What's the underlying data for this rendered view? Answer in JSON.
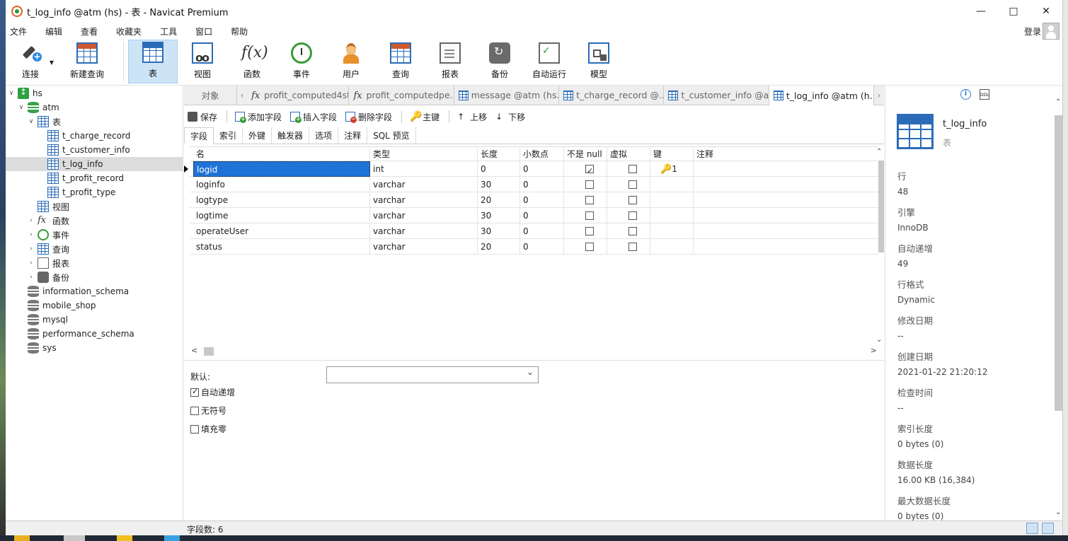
{
  "window": {
    "title": "t_log_info @atm (hs) - 表 - Navicat Premium"
  },
  "menu": {
    "items": [
      "文件",
      "编辑",
      "查看",
      "收藏夹",
      "工具",
      "窗口",
      "帮助"
    ],
    "login": "登录"
  },
  "toolbar": {
    "connect": "连接",
    "new_query": "新建查询",
    "table": "表",
    "view": "视图",
    "function": "函数",
    "event": "事件",
    "user": "用户",
    "query": "查询",
    "report": "报表",
    "backup": "备份",
    "automation": "自动运行",
    "model": "模型"
  },
  "tree": {
    "connection": "hs",
    "database": "atm",
    "tables_group": "表",
    "tables": [
      "t_charge_record",
      "t_customer_info",
      "t_log_info",
      "t_profit_record",
      "t_profit_type"
    ],
    "groups": [
      "视图",
      "函数",
      "事件",
      "查询",
      "报表",
      "备份"
    ],
    "other_dbs": [
      "information_schema",
      "mobile_shop",
      "mysql",
      "performance_schema",
      "sys"
    ]
  },
  "tabs": {
    "objects": "对象",
    "items": [
      "profit_computed4st...",
      "profit_computedpe...",
      "message @atm (hs...",
      "t_charge_record @...",
      "t_customer_info @a...",
      "t_log_info @atm (h..."
    ]
  },
  "actions": {
    "save": "保存",
    "add_field": "添加字段",
    "insert_field": "插入字段",
    "delete_field": "删除字段",
    "primary_key": "主键",
    "move_up": "上移",
    "move_down": "下移"
  },
  "field_tabs": [
    "字段",
    "索引",
    "外键",
    "触发器",
    "选项",
    "注释",
    "SQL 预览"
  ],
  "grid": {
    "headers": [
      "名",
      "类型",
      "长度",
      "小数点",
      "不是 null",
      "虚拟",
      "键",
      "注释"
    ],
    "rows": [
      {
        "name": "logid",
        "type": "int",
        "length": "0",
        "decimals": "0",
        "not_null": true,
        "virtual": false,
        "key": "1"
      },
      {
        "name": "loginfo",
        "type": "varchar",
        "length": "30",
        "decimals": "0",
        "not_null": false,
        "virtual": false,
        "key": ""
      },
      {
        "name": "logtype",
        "type": "varchar",
        "length": "20",
        "decimals": "0",
        "not_null": false,
        "virtual": false,
        "key": ""
      },
      {
        "name": "logtime",
        "type": "varchar",
        "length": "30",
        "decimals": "0",
        "not_null": false,
        "virtual": false,
        "key": ""
      },
      {
        "name": "operateUser",
        "type": "varchar",
        "length": "30",
        "decimals": "0",
        "not_null": false,
        "virtual": false,
        "key": ""
      },
      {
        "name": "status",
        "type": "varchar",
        "length": "20",
        "decimals": "0",
        "not_null": false,
        "virtual": false,
        "key": ""
      }
    ]
  },
  "props": {
    "default_label": "默认:",
    "auto_increment": "自动递增",
    "unsigned": "无符号",
    "zerofill": "填充零",
    "auto_increment_checked": true
  },
  "status": {
    "field_count": "字段数: 6"
  },
  "info": {
    "name": "t_log_info",
    "type": "表",
    "ddl": "DDL",
    "fields": [
      {
        "k": "行",
        "v": "48"
      },
      {
        "k": "引擎",
        "v": "InnoDB"
      },
      {
        "k": "自动递增",
        "v": "49"
      },
      {
        "k": "行格式",
        "v": "Dynamic"
      },
      {
        "k": "修改日期",
        "v": "--"
      },
      {
        "k": "创建日期",
        "v": "2021-01-22 21:20:12"
      },
      {
        "k": "检查时间",
        "v": "--"
      },
      {
        "k": "索引长度",
        "v": "0 bytes (0)"
      },
      {
        "k": "数据长度",
        "v": "16.00 KB (16,384)"
      },
      {
        "k": "最大数据长度",
        "v": "0 bytes (0)"
      }
    ]
  },
  "colors": {
    "accent": "#1f72d6",
    "active_tool": "#cde4f7",
    "table_icon": "#2b6cb8"
  }
}
